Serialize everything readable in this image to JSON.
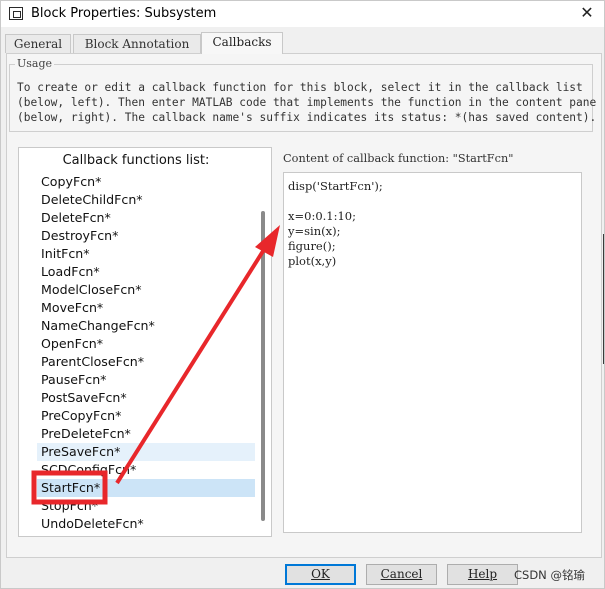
{
  "window": {
    "title": "Block Properties: Subsystem",
    "close_glyph": "✕"
  },
  "tabs": [
    {
      "label": "General",
      "active": false
    },
    {
      "label": "Block Annotation",
      "active": false
    },
    {
      "label": "Callbacks",
      "active": true
    }
  ],
  "usage": {
    "legend": "Usage",
    "lines": [
      "To create or edit a callback function for this block, select it in the callback list",
      "(below, left). Then enter MATLAB code that implements the function in the content pane",
      "(below, right). The callback name's suffix indicates its status: *(has saved content)."
    ]
  },
  "callback_list": {
    "header": "Callback functions list:",
    "items": [
      "CopyFcn*",
      "DeleteChildFcn*",
      "DeleteFcn*",
      "DestroyFcn*",
      "InitFcn*",
      "LoadFcn*",
      "ModelCloseFcn*",
      "MoveFcn*",
      "NameChangeFcn*",
      "OpenFcn*",
      "ParentCloseFcn*",
      "PauseFcn*",
      "PostSaveFcn*",
      "PreCopyFcn*",
      "PreDeleteFcn*",
      "PreSaveFcn*",
      "SCDConfigFcn*",
      "StartFcn*",
      "StopFcn*",
      "UndoDeleteFcn*"
    ],
    "hovered": "PreSaveFcn*",
    "selected": "StartFcn*"
  },
  "content": {
    "label": "Content of callback function: \"StartFcn\"",
    "code_lines": [
      "disp('StartFcn');",
      "",
      "x=0:0.1:10;",
      "y=sin(x);",
      "figure();",
      "plot(x,y)"
    ]
  },
  "buttons": {
    "ok": "OK",
    "cancel": "Cancel",
    "help": "Help"
  },
  "watermark": "CSDN @铭瑜",
  "colors": {
    "annotation_red": "#e8272b",
    "selected_bg": "#cce4f7",
    "hover_bg": "#e5f1fb",
    "default_button_border": "#0078d7"
  }
}
